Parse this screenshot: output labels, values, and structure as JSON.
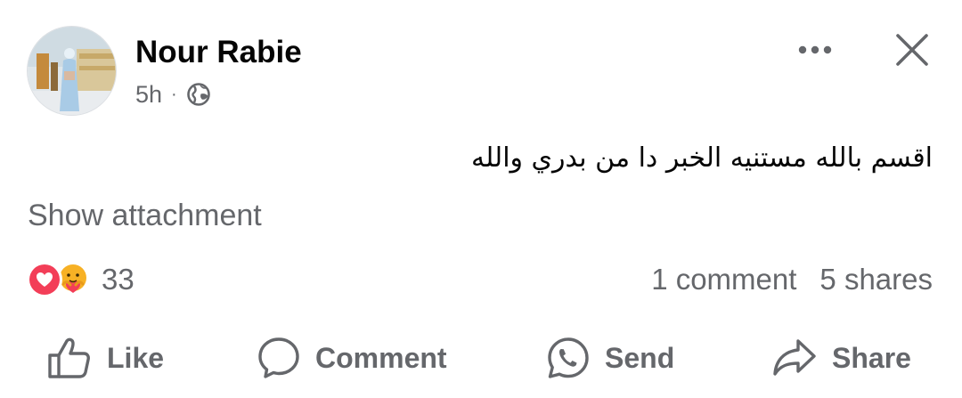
{
  "post": {
    "author": "Nour Rabie",
    "time": "5h",
    "separator": "·",
    "privacy_icon": "globe-icon",
    "text": "اقسم بالله مستنيه الخبر دا من بدري والله",
    "attachment_label": "Show attachment"
  },
  "reactions": {
    "icons": [
      "love-icon",
      "care-icon"
    ],
    "count": "33",
    "comments": "1 comment",
    "shares": "5 shares"
  },
  "actions": {
    "like": "Like",
    "comment": "Comment",
    "send": "Send",
    "share": "Share"
  },
  "colors": {
    "text_primary": "#050505",
    "text_secondary": "#65676b",
    "love_red": "#f33e58",
    "care_yellow": "#f7b125"
  }
}
